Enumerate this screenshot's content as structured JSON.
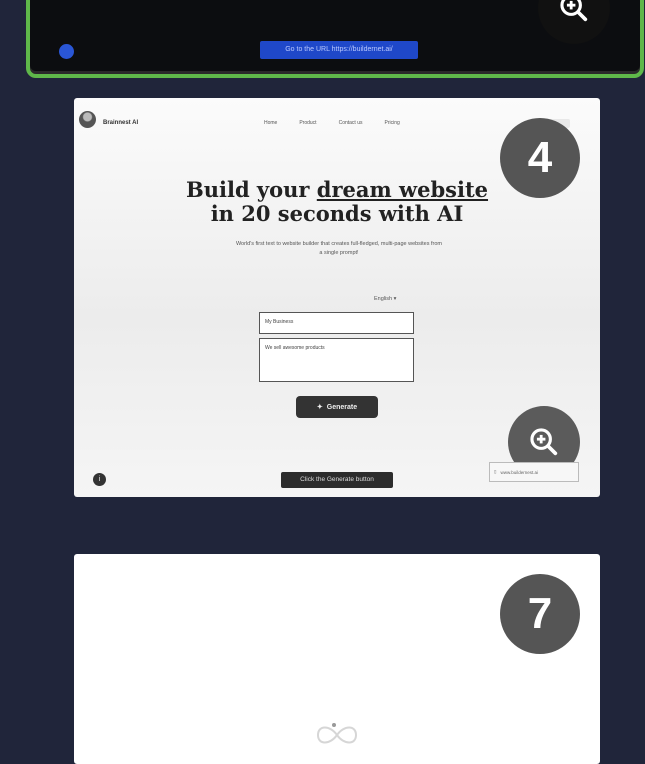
{
  "steps": [
    {
      "caption": "Go to the URL https://buildernet.ai/"
    },
    {
      "number": "4",
      "caption": "Click the Generate button",
      "preview": {
        "brand": "Brainnest AI",
        "nav": [
          "Home",
          "Product",
          "Contact us",
          "Pricing"
        ],
        "title_line1_pre": "Build your ",
        "title_line1_em": "dream website",
        "title_line2": "in 20 seconds with AI",
        "subtitle": "World's first text to website builder that creates full-fledged, multi-page websites from a single prompt!",
        "language": "English",
        "business_field": "My Business",
        "description_field": "We sell awesome products",
        "generate_label": "Generate",
        "side_note": "www.buildernest.ai"
      }
    },
    {
      "number": "7"
    }
  ],
  "icons": {
    "zoom": "zoom-in-icon",
    "sparkle": "sparkle-icon",
    "info": "info-icon",
    "loader": "infinity-loader-icon"
  },
  "colors": {
    "background": "#20253a",
    "selected_border": "#5fb84a",
    "caption_blue": "#1f48c9",
    "badge": "#555555"
  }
}
